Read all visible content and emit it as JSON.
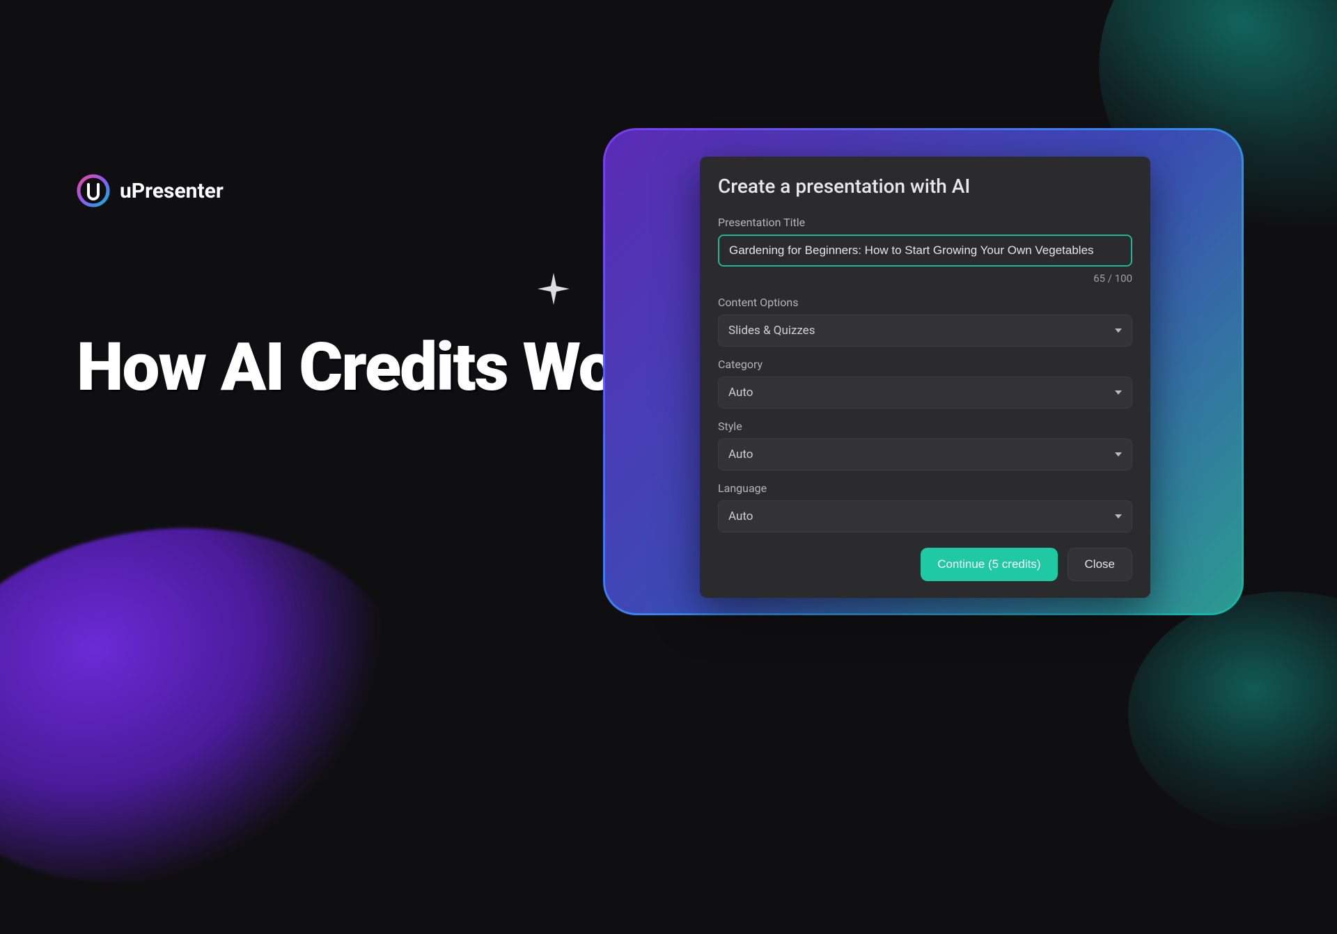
{
  "brand": {
    "name": "uPresenter"
  },
  "headline": "How AI Credits Work?",
  "dialog": {
    "title": "Create a presentation with AI",
    "title_field": {
      "label": "Presentation Title",
      "value": "Gardening for Beginners: How to Start Growing Your Own Vegetables",
      "count": "65 / 100"
    },
    "content_options": {
      "label": "Content Options",
      "value": "Slides & Quizzes"
    },
    "category": {
      "label": "Category",
      "value": "Auto"
    },
    "style": {
      "label": "Style",
      "value": "Auto"
    },
    "language": {
      "label": "Language",
      "value": "Auto"
    },
    "buttons": {
      "continue": "Continue (5 credits)",
      "close": "Close"
    }
  }
}
